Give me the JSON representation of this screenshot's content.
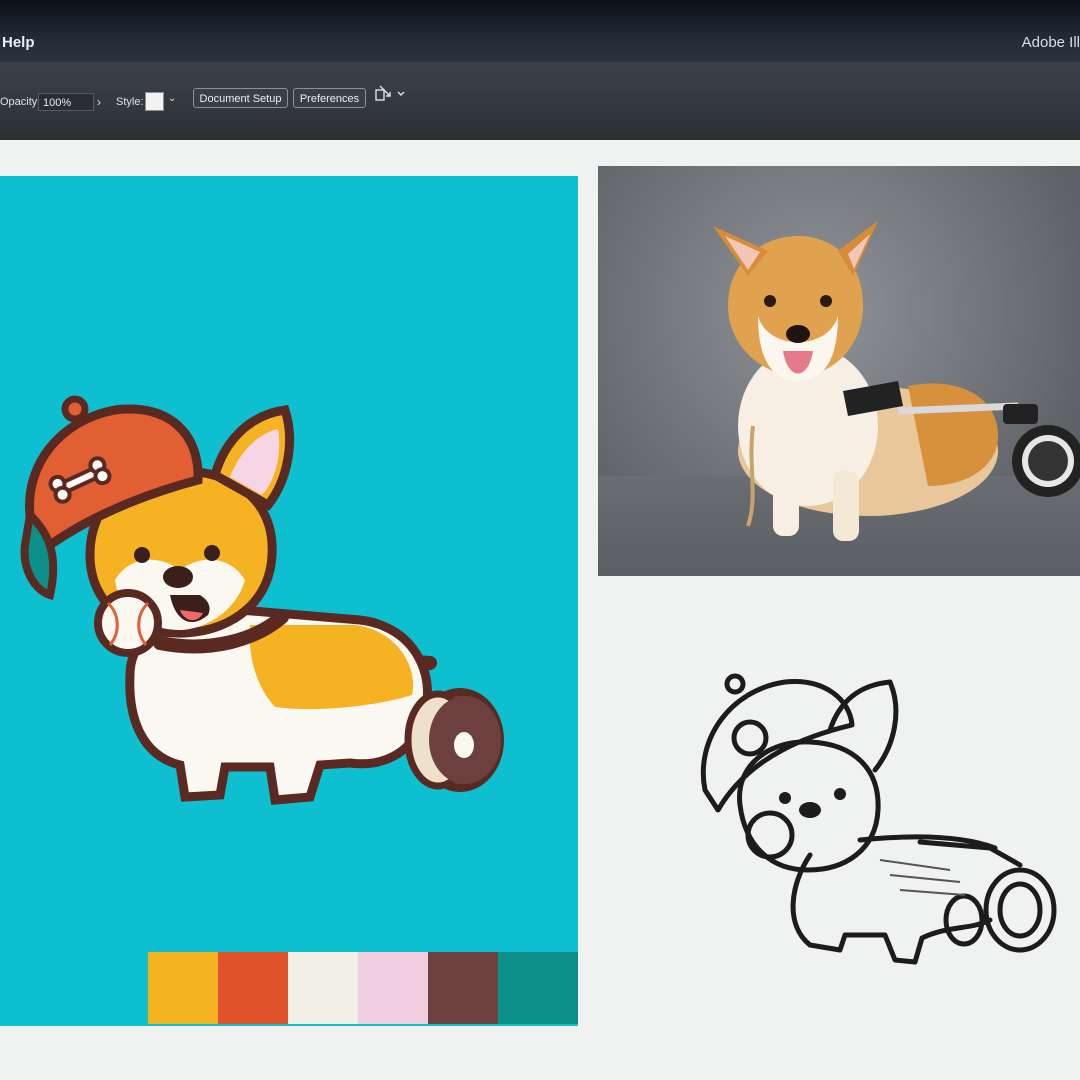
{
  "menubar": {
    "help_label": "Help",
    "app_title": "Adobe Ill"
  },
  "toolbar": {
    "opacity_label": "Opacity:",
    "opacity_value": "100%",
    "style_label": "Style:",
    "document_setup_label": "Document Setup",
    "preferences_label": "Preferences"
  },
  "palette": [
    "#f4b321",
    "#e0532a",
    "#f2efe6",
    "#f1cfe0",
    "#6e3f3f",
    "#0c8f8a"
  ],
  "colors": {
    "teal": "#0ec0cf",
    "cap_orange": "#e25f33",
    "corgi_yellow": "#f5b324",
    "outline": "#5a2a22"
  },
  "icons": [
    "bone-icon",
    "baseball-icon",
    "wheel-icon",
    "arrange-icon",
    "chevron-down-icon"
  ]
}
